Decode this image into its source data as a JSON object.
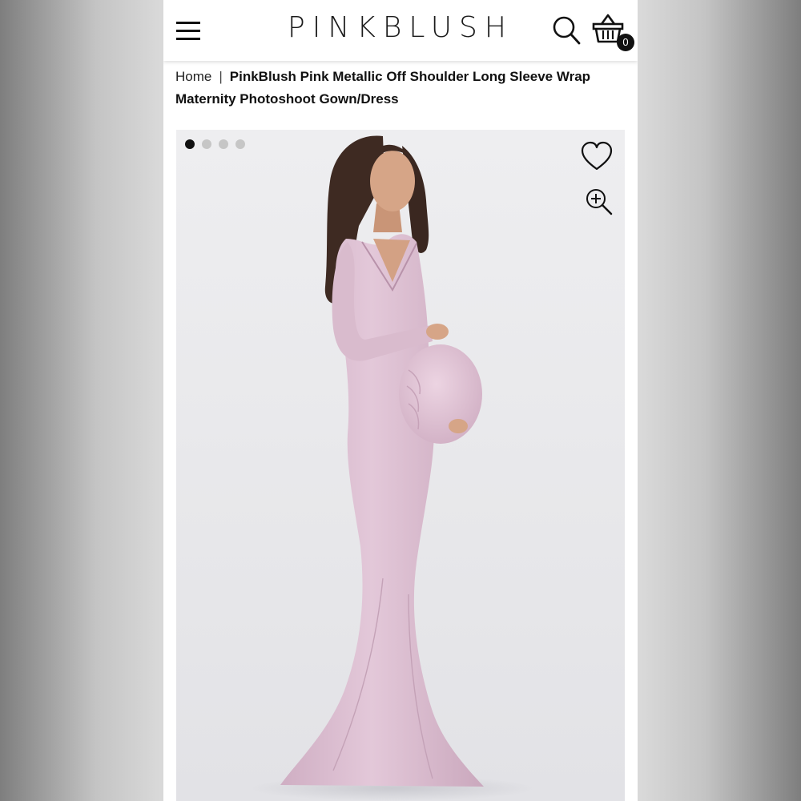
{
  "header": {
    "logo": "PINKBLUSH",
    "cart_count": "0"
  },
  "breadcrumb": {
    "home": "Home",
    "separator": "|",
    "current": "PinkBlush Pink Metallic Off Shoulder Long Sleeve Wrap Maternity Photoshoot Gown/Dress"
  },
  "gallery": {
    "slide_count": 4,
    "active_slide": 1
  },
  "icons": {
    "menu": "hamburger-menu-icon",
    "search": "search-icon",
    "cart": "shopping-basket-icon",
    "favorite": "heart-icon",
    "zoom": "zoom-in-icon"
  },
  "colors": {
    "dress": "#dcbcd0",
    "background": "#ececee",
    "accent": "#111111"
  }
}
